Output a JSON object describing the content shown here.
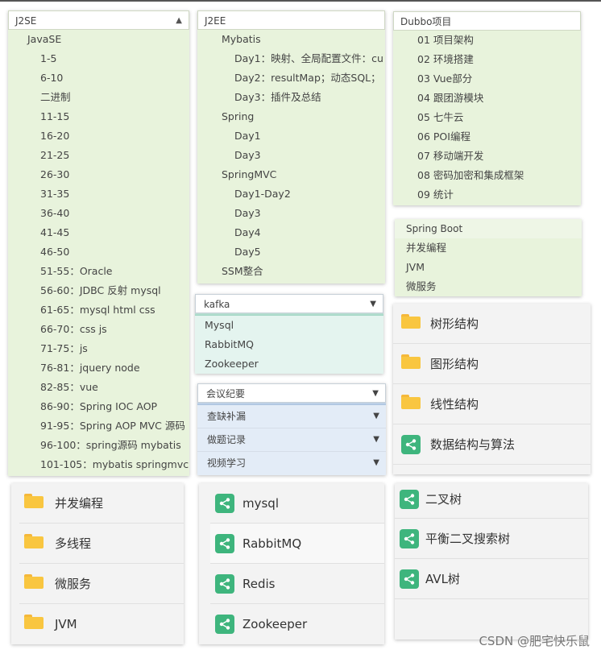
{
  "j2se": {
    "title": "J2SE",
    "items": [
      {
        "label": "JavaSE"
      },
      {
        "label": "1-5"
      },
      {
        "label": "6-10"
      },
      {
        "label": "二进制"
      },
      {
        "label": "11-15"
      },
      {
        "label": "16-20"
      },
      {
        "label": "21-25"
      },
      {
        "label": "26-30"
      },
      {
        "label": "31-35"
      },
      {
        "label": "36-40"
      },
      {
        "label": "41-45"
      },
      {
        "label": "46-50"
      },
      {
        "label": "51-55：Oracle"
      },
      {
        "label": "56-60：JDBC 反射 mysql"
      },
      {
        "label": "61-65：mysql html css"
      },
      {
        "label": "66-70：css js"
      },
      {
        "label": "71-75：js"
      },
      {
        "label": "76-81：jquery node"
      },
      {
        "label": "82-85：vue"
      },
      {
        "label": "86-90：Spring IOC AOP"
      },
      {
        "label": "91-95：Spring AOP MVC 源码"
      },
      {
        "label": "96-100：spring源码 mybatis"
      },
      {
        "label": "101-105：mybatis springmvc"
      }
    ]
  },
  "j2ee": {
    "title": "J2EE",
    "items": [
      {
        "label": "Mybatis"
      },
      {
        "label": "Day1：映射、全局配置文件：cu"
      },
      {
        "label": "Day2：resultMap；动态SQL；"
      },
      {
        "label": "Day3：插件及总结"
      },
      {
        "label": "Spring"
      },
      {
        "label": "Day1"
      },
      {
        "label": "Day3"
      },
      {
        "label": "SpringMVC"
      },
      {
        "label": "Day1-Day2"
      },
      {
        "label": "Day3"
      },
      {
        "label": "Day4"
      },
      {
        "label": "Day5"
      },
      {
        "label": "SSM整合"
      }
    ]
  },
  "dubbo": {
    "title": "Dubbo项目",
    "items": [
      {
        "label": "01 项目架构"
      },
      {
        "label": "02 环境搭建"
      },
      {
        "label": "03 Vue部分"
      },
      {
        "label": "04 跟团游模块"
      },
      {
        "label": "05 七牛云"
      },
      {
        "label": "06 POI编程"
      },
      {
        "label": "07 移动端开发"
      },
      {
        "label": "08 密码加密和集成框架"
      },
      {
        "label": "09 统计"
      }
    ]
  },
  "springboot": {
    "title": "Spring Boot",
    "items": [
      {
        "label": "并发编程"
      },
      {
        "label": "JVM"
      },
      {
        "label": "微服务"
      }
    ]
  },
  "kafka": {
    "selected": "kafka",
    "items": [
      {
        "label": "Mysql"
      },
      {
        "label": "RabbitMQ"
      },
      {
        "label": "Zookeeper"
      }
    ]
  },
  "meeting": {
    "selected": "会议纪要",
    "items": [
      {
        "label": "查缺补漏"
      },
      {
        "label": "做题记录"
      },
      {
        "label": "视频学习"
      }
    ]
  },
  "ds_list": {
    "items": [
      {
        "label": "树形结构",
        "icon": "folder-icon"
      },
      {
        "label": "图形结构",
        "icon": "folder-icon"
      },
      {
        "label": "线性结构",
        "icon": "folder-icon"
      },
      {
        "label": "数据结构与算法",
        "icon": "share-icon"
      }
    ]
  },
  "bottom_left": {
    "items": [
      {
        "label": "并发编程",
        "icon": "folder-icon"
      },
      {
        "label": "多线程",
        "icon": "folder-icon"
      },
      {
        "label": "微服务",
        "icon": "folder-icon"
      },
      {
        "label": "JVM",
        "icon": "folder-icon"
      }
    ]
  },
  "bottom_mid": {
    "items": [
      {
        "label": "mysql",
        "icon": "share-icon"
      },
      {
        "label": "RabbitMQ",
        "icon": "share-icon"
      },
      {
        "label": "Redis",
        "icon": "share-icon"
      },
      {
        "label": "Zookeeper",
        "icon": "share-icon"
      }
    ]
  },
  "bottom_right": {
    "items": [
      {
        "label": "二叉树",
        "icon": "share-icon"
      },
      {
        "label": "平衡二叉搜索树",
        "icon": "share-icon"
      },
      {
        "label": "AVL树",
        "icon": "share-icon"
      }
    ]
  },
  "watermark": "CSDN @肥宅快乐鼠",
  "colors": {
    "green_panel": "#e8f3dc",
    "teal_panel": "#e4f4ef",
    "blue_panel": "#e3ecf7",
    "folder": "#f9c640",
    "share": "#3eb57d"
  }
}
